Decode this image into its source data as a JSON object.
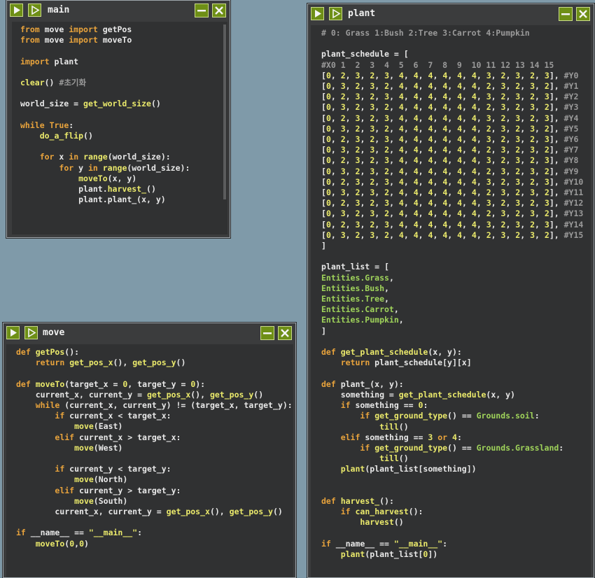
{
  "windows": {
    "main": {
      "title": "main",
      "code": "from move import getPos\nfrom move import moveTo\n\nimport plant\n\nclear() #초기화\n\nworld_size = get_world_size()\n\nwhile True:\n    do_a_flip()\n\n    for x in range(world_size):\n        for y in range(world_size):\n            moveTo(x, y)\n            plant.harvest_()\n            plant.plant_(x, y)"
    },
    "move": {
      "title": "move",
      "code": "def getPos():\n    return get_pos_x(), get_pos_y()\n\ndef moveTo(target_x = 0, target_y = 0):\n    current_x, current_y = get_pos_x(), get_pos_y()\n    while (current_x, current_y) != (target_x, target_y):\n        if current_x < target_x:\n            move(East)\n        elif current_x > target_x:\n            move(West)\n\n        if current_y < target_y:\n            move(North)\n        elif current_y > target_y:\n            move(South)\n        current_x, current_y = get_pos_x(), get_pos_y()\n\nif __name__ == \"__main__\":\n    moveTo(0,0)"
    },
    "plant": {
      "title": "plant",
      "code": "# 0: Grass 1:Bush 2:Tree 3:Carrot 4:Pumpkin\n\nplant_schedule = [\n#X0 1  2  3  4  5  6  7  8  9  10 11 12 13 14 15\n[0, 2, 3, 2, 3, 4, 4, 4, 4, 4, 4, 3, 2, 3, 2, 3], #Y0\n[0, 3, 2, 3, 2, 4, 4, 4, 4, 4, 4, 2, 3, 2, 3, 2], #Y1\n[0, 2, 3, 2, 3, 4, 4, 4, 4, 4, 4, 3, 2, 3, 2, 3], #Y2\n[0, 3, 2, 3, 2, 4, 4, 4, 4, 4, 4, 2, 3, 2, 3, 2], #Y3\n[0, 2, 3, 2, 3, 4, 4, 4, 4, 4, 4, 3, 2, 3, 2, 3], #Y4\n[0, 3, 2, 3, 2, 4, 4, 4, 4, 4, 4, 2, 3, 2, 3, 2], #Y5\n[0, 2, 3, 2, 3, 4, 4, 4, 4, 4, 4, 3, 2, 3, 2, 3], #Y6\n[0, 3, 2, 3, 2, 4, 4, 4, 4, 4, 4, 2, 3, 2, 3, 2], #Y7\n[0, 2, 3, 2, 3, 4, 4, 4, 4, 4, 4, 3, 2, 3, 2, 3], #Y8\n[0, 3, 2, 3, 2, 4, 4, 4, 4, 4, 4, 2, 3, 2, 3, 2], #Y9\n[0, 2, 3, 2, 3, 4, 4, 4, 4, 4, 4, 3, 2, 3, 2, 3], #Y10\n[0, 3, 2, 3, 2, 4, 4, 4, 4, 4, 4, 2, 3, 2, 3, 2], #Y11\n[0, 2, 3, 2, 3, 4, 4, 4, 4, 4, 4, 3, 2, 3, 2, 3], #Y12\n[0, 3, 2, 3, 2, 4, 4, 4, 4, 4, 4, 2, 3, 2, 3, 2], #Y13\n[0, 2, 3, 2, 3, 4, 4, 4, 4, 4, 4, 3, 2, 3, 2, 3], #Y14\n[0, 3, 2, 3, 2, 4, 4, 4, 4, 4, 4, 2, 3, 2, 3, 2], #Y15\n]\n\nplant_list = [\nEntities.Grass,\nEntities.Bush,\nEntities.Tree,\nEntities.Carrot,\nEntities.Pumpkin,\n]\n\ndef get_plant_schedule(x, y):\n    return plant_schedule[y][x]\n\ndef plant_(x, y):\n    something = get_plant_schedule(x, y)\n    if something == 0:\n        if get_ground_type() == Grounds.soil:\n            till()\n    elif something == 3 or 4:\n        if get_ground_type() == Grounds.Grassland:\n            till()\n    plant(plant_list[something])\n\n\ndef harvest_():\n    if can_harvest():\n        harvest()\n\nif __name__ == \"__main__\":\n    plant(plant_list[0])"
    }
  },
  "icons": {
    "run": "play-solid-icon",
    "step": "play-outline-icon",
    "minimize": "minimize-icon",
    "close": "close-icon"
  },
  "colors": {
    "background": "#7f9aa9",
    "window": "#3b3c3d",
    "editor": "#303132",
    "button_green": "#6e8f16",
    "keyword": "#e8a33c",
    "function": "#eae96b",
    "entity": "#9fd35a",
    "comment": "#9a9a9a"
  }
}
